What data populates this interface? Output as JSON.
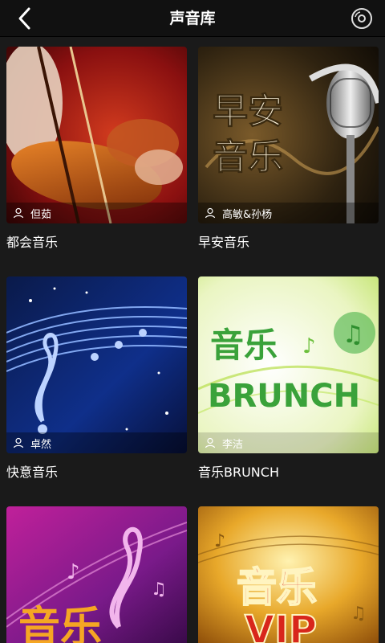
{
  "header": {
    "title": "声音库"
  },
  "cards": [
    {
      "title": "都会音乐",
      "author": "但茹"
    },
    {
      "title": "早安音乐",
      "author": "高敏&孙杨",
      "art_text_1": "早安",
      "art_text_2": "音乐"
    },
    {
      "title": "快意音乐",
      "author": "卓然"
    },
    {
      "title": "音乐BRUNCH",
      "author": "李洁",
      "art_text_1": "音乐",
      "art_text_2": "BRUNCH"
    },
    {
      "art_text_1": "音乐"
    },
    {
      "art_text_1": "音乐",
      "art_text_2": "VIP"
    }
  ],
  "colors": {
    "header_bg": "#111111",
    "page_bg": "#1a1a1a",
    "brunch_green": "#3aa23a",
    "vip_red": "#d8261c"
  }
}
